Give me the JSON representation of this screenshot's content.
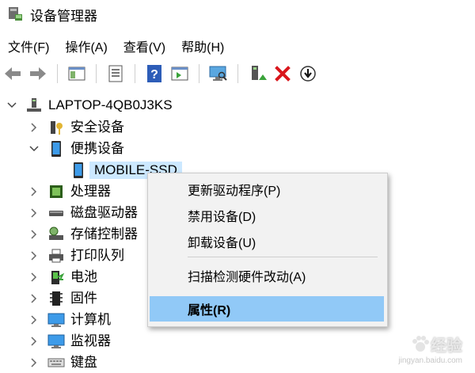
{
  "window": {
    "title": "设备管理器"
  },
  "menubar": {
    "items": [
      "文件(F)",
      "操作(A)",
      "查看(V)",
      "帮助(H)"
    ]
  },
  "toolbar": {
    "icons": [
      "back-icon",
      "forward-icon",
      "show-hide-console-tree-icon",
      "properties-icon",
      "help-icon",
      "action-pane-icon",
      "monitor-scan-icon",
      "update-driver-icon",
      "uninstall-icon",
      "disable-device-icon"
    ]
  },
  "tree": {
    "root": "LAPTOP-4QB0J3KS",
    "items": [
      {
        "label": "安全设备",
        "icon": "security-key-icon",
        "expanded": false
      },
      {
        "label": "便携设备",
        "icon": "portable-device-icon",
        "expanded": true
      },
      {
        "label": "MOBILE-SSD",
        "icon": "portable-device-icon",
        "selected": true
      },
      {
        "label": "处理器",
        "icon": "processor-icon",
        "expanded": false
      },
      {
        "label": "磁盘驱动器",
        "icon": "disk-drive-icon",
        "expanded": false
      },
      {
        "label": "存储控制器",
        "icon": "storage-controller-icon",
        "expanded": false
      },
      {
        "label": "打印队列",
        "icon": "printer-icon",
        "expanded": false
      },
      {
        "label": "电池",
        "icon": "battery-icon",
        "expanded": false
      },
      {
        "label": "固件",
        "icon": "firmware-icon",
        "expanded": false
      },
      {
        "label": "计算机",
        "icon": "computer-icon",
        "expanded": false
      },
      {
        "label": "监视器",
        "icon": "monitor-icon",
        "expanded": false
      },
      {
        "label": "键盘",
        "icon": "keyboard-icon",
        "expanded": false
      }
    ]
  },
  "context_menu": {
    "items": [
      "更新驱动程序(P)",
      "禁用设备(D)",
      "卸载设备(U)",
      "扫描检测硬件改动(A)",
      "属性(R)"
    ],
    "highlighted": "属性(R)"
  },
  "watermark": {
    "text": "经验",
    "sub": "jingyan.baidu.com"
  },
  "colors": {
    "selection": "#cce8ff",
    "menu_highlight": "#91c9f7",
    "menu_bg": "#f2f2f2"
  }
}
